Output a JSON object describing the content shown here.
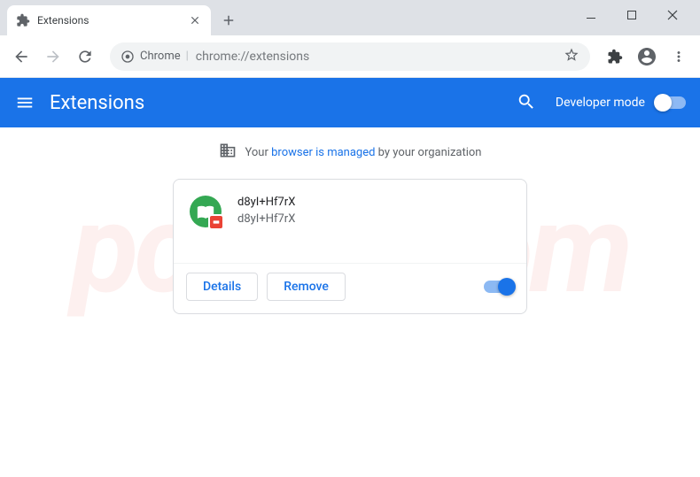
{
  "window": {
    "tab": {
      "title": "Extensions"
    }
  },
  "address_bar": {
    "security_label": "Chrome",
    "url": "chrome://extensions"
  },
  "header": {
    "title": "Extensions",
    "developer_mode_label": "Developer mode",
    "developer_mode_on": false
  },
  "managed_banner": {
    "prefix": "Your ",
    "link_text": "browser is managed",
    "suffix": " by your organization"
  },
  "extension": {
    "name": "d8yI+Hf7rX",
    "description": "d8yI+Hf7rX",
    "details_label": "Details",
    "remove_label": "Remove",
    "enabled": true
  },
  "watermark": "pcrisk.com"
}
